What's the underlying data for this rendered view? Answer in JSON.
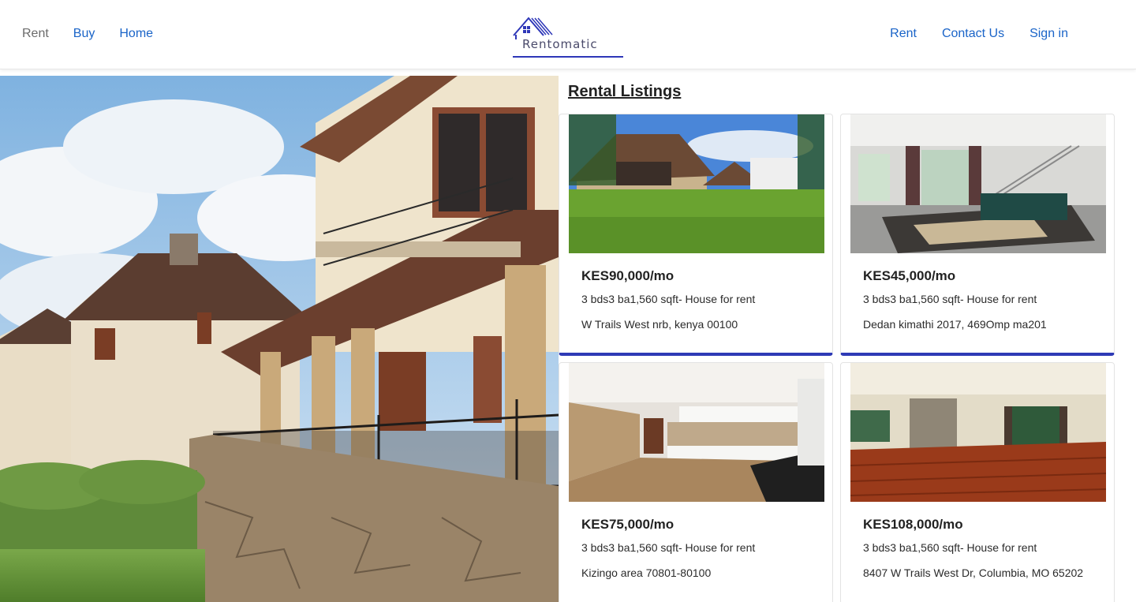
{
  "header": {
    "nav_left": [
      {
        "label": "Rent",
        "muted": true
      },
      {
        "label": "Buy"
      },
      {
        "label": "Home"
      }
    ],
    "logo_text": "Rentomatic",
    "nav_right": [
      {
        "label": "Rent"
      },
      {
        "label": "Contact Us"
      },
      {
        "label": "Sign in"
      }
    ],
    "link_color": "#1a64c8",
    "brand_color": "#2e37b8"
  },
  "hero": {
    "image": "large-villa-photo"
  },
  "listings": {
    "title": "Rental Listings",
    "cards": [
      {
        "price": "KES90,000/mo",
        "specs": "3 bds3 ba1,560 sqft- House for rent",
        "address": "W Trails West nrb, kenya 00100",
        "image": "house-exterior-lawn-photo"
      },
      {
        "price": "KES45,000/mo",
        "specs": "3 bds3 ba1,560 sqft- House for rent",
        "address": "Dedan kimathi 2017, 469Omp ma201",
        "image": "living-room-staircase-photo"
      },
      {
        "price": "KES75,000/mo",
        "specs": "3 bds3 ba1,560 sqft- House for rent",
        "address": "Kizingo area 70801-80100",
        "image": "kitchen-photo"
      },
      {
        "price": "KES108,000/mo",
        "specs": "3 bds3 ba1,560 sqft- House for rent",
        "address": "8407 W Trails West Dr, Columbia, MO 65202",
        "image": "empty-room-wood-floor-photo"
      }
    ]
  }
}
